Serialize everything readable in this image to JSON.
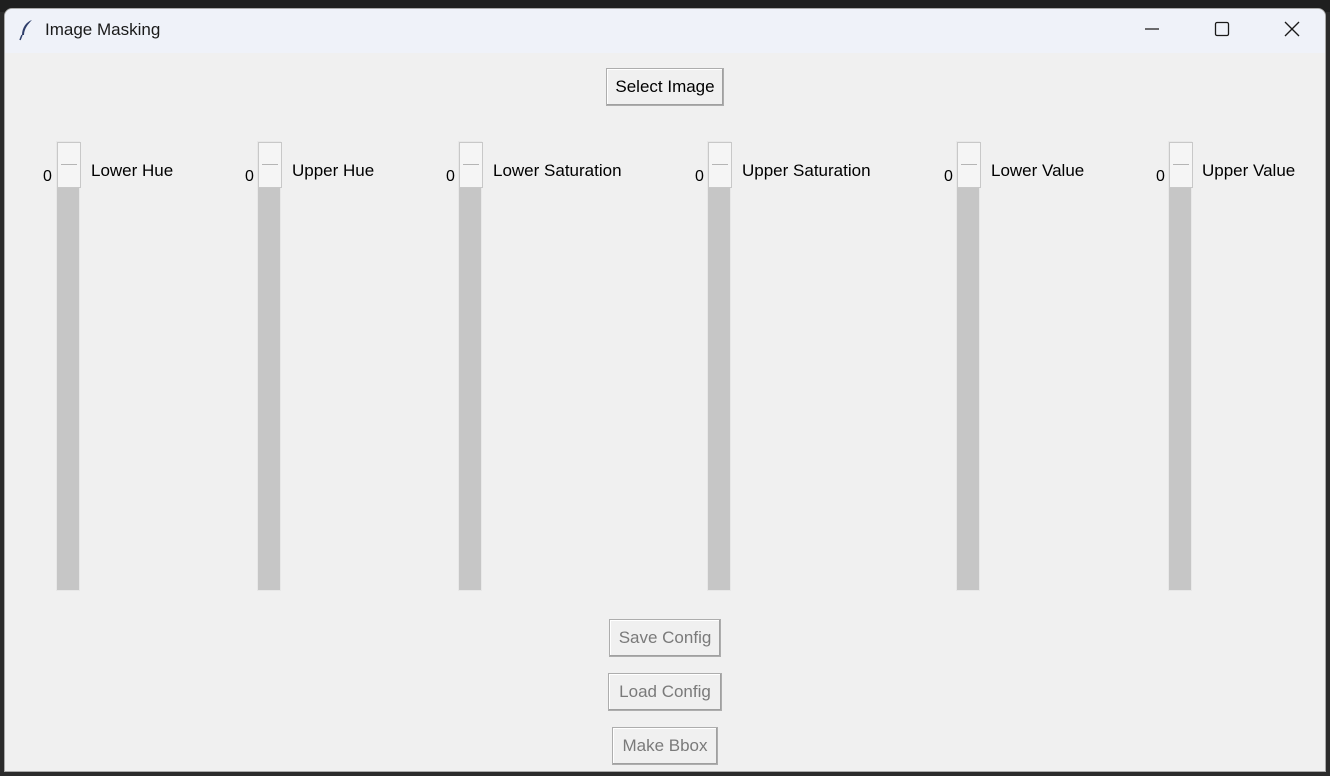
{
  "window": {
    "title": "Image Masking"
  },
  "buttons": {
    "select_image": "Select Image",
    "save_config": "Save Config",
    "load_config": "Load Config",
    "make_bbox": "Make Bbox"
  },
  "sliders": [
    {
      "label": "Lower Hue",
      "value": "0"
    },
    {
      "label": "Upper Hue",
      "value": "0"
    },
    {
      "label": "Lower Saturation",
      "value": "0"
    },
    {
      "label": "Upper Saturation",
      "value": "0"
    },
    {
      "label": "Lower Value",
      "value": "0"
    },
    {
      "label": "Upper Value",
      "value": "0"
    }
  ],
  "icons": {
    "app": "feather-icon",
    "minimize": "minimize-icon",
    "maximize": "maximize-icon",
    "close": "close-icon"
  },
  "colors": {
    "titlebar": "#eff2f9",
    "window_bg": "#f0f0f0",
    "trough": "#c6c6c6",
    "disabled_text": "#7a7a7a"
  }
}
